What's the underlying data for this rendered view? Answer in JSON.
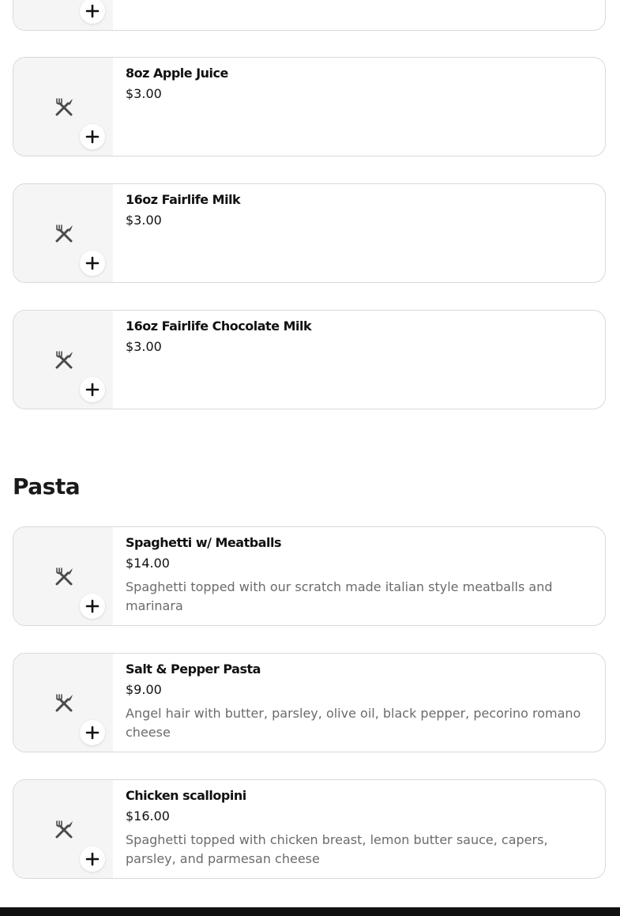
{
  "sections": [
    {
      "title": "",
      "items": [
        {
          "name": "",
          "price": "",
          "description": ""
        },
        {
          "name": "8oz Apple Juice",
          "price": "$3.00",
          "description": ""
        },
        {
          "name": "16oz Fairlife Milk",
          "price": "$3.00",
          "description": ""
        },
        {
          "name": "16oz Fairlife Chocolate Milk",
          "price": "$3.00",
          "description": ""
        }
      ]
    },
    {
      "title": "Pasta",
      "items": [
        {
          "name": "Spaghetti w/ Meatballs",
          "price": "$14.00",
          "description": "Spaghetti topped with our scratch made italian style meatballs and marinara"
        },
        {
          "name": "Salt & Pepper Pasta",
          "price": "$9.00",
          "description": "Angel hair with butter, parsley, olive oil, black pepper, pecorino romano cheese"
        },
        {
          "name": "Chicken scallopini",
          "price": "$16.00",
          "description": "Spaghetti topped with chicken breast, lemon butter sauce, capers, parsley, and parmesan cheese"
        }
      ]
    }
  ],
  "icons": {
    "item_placeholder": "utensils-icon",
    "add": "plus-icon"
  },
  "colors": {
    "card_border": "#d9d9d9",
    "thumb_bg": "#f5f5f5",
    "description": "#6b6b6b",
    "footer": "#111111"
  }
}
